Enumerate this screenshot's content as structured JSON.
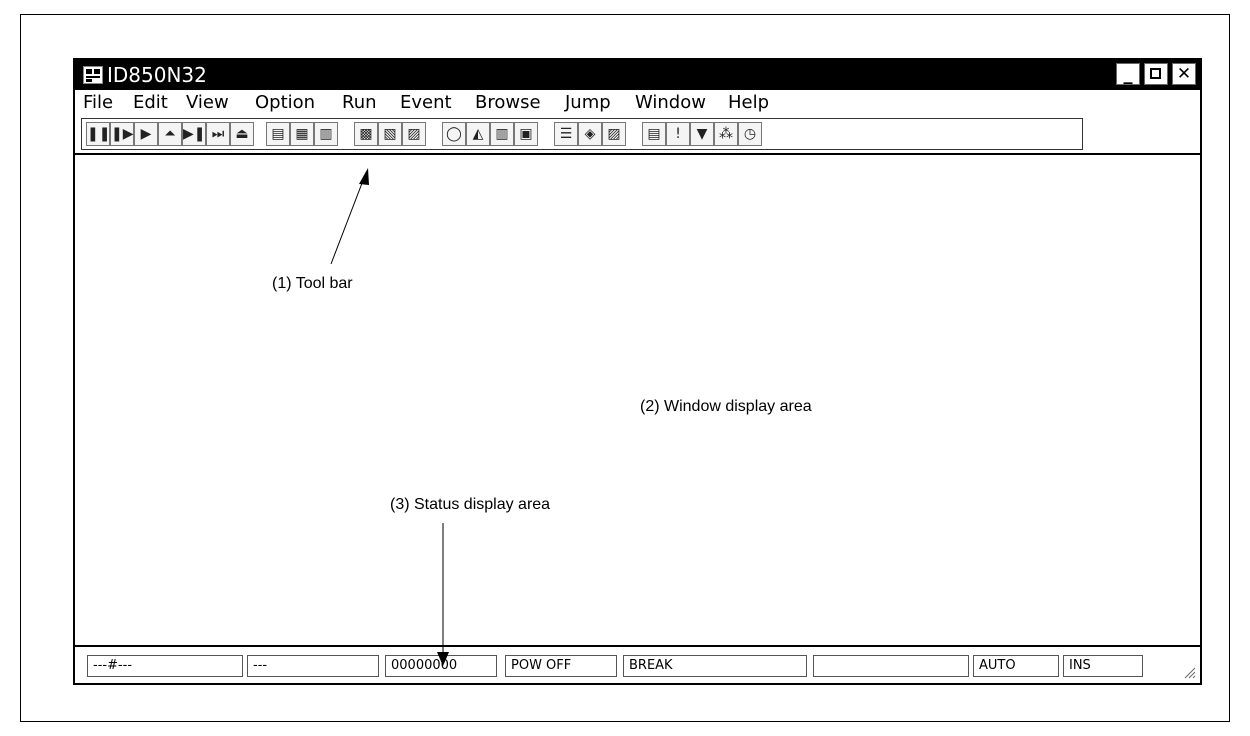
{
  "window": {
    "title": "ID850N32"
  },
  "menu": [
    "File",
    "Edit",
    "View",
    "Option",
    "Run",
    "Event",
    "Browse",
    "Jump",
    "Window",
    "Help"
  ],
  "toolbar": {
    "groups": [
      [
        "stop-icon",
        "step-in-icon",
        "go-icon",
        "start-from-here-icon",
        "come-here-icon",
        "return-out-icon",
        "restart-icon"
      ],
      [
        "source-icon",
        "assemble-icon",
        "memory-icon"
      ],
      [
        "register-icon",
        "io-register-icon",
        "timer-icon"
      ],
      [
        "watch-icon",
        "quick-watch-icon",
        "stack-icon",
        "local-variable-icon"
      ],
      [
        "trace-icon",
        "coverage-icon",
        "event-manager-icon"
      ],
      [
        "event-condition-icon",
        "trace-condition-icon",
        "snap-condition-icon",
        "stub-condition-icon",
        "timer-condition-icon"
      ]
    ]
  },
  "status": [
    "---#---",
    "---",
    "00000000",
    "POW OFF",
    "BREAK",
    "",
    "AUTO",
    "INS"
  ],
  "annotations": {
    "toolbar": "(1) Tool bar",
    "window_area": "(2) Window display area",
    "status_area": "(3) Status display area"
  }
}
